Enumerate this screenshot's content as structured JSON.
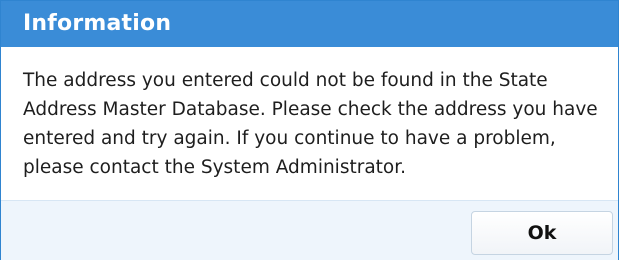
{
  "dialog": {
    "title": "Information",
    "message": "The address you entered could not be found in the State Address Master Database. Please check the address you have entered and try again. If you continue to have a problem, please contact the System Administrator.",
    "ok_label": "Ok"
  },
  "colors": {
    "title_bar": "#3a8cd7",
    "footer_background": "#eef5fc"
  }
}
